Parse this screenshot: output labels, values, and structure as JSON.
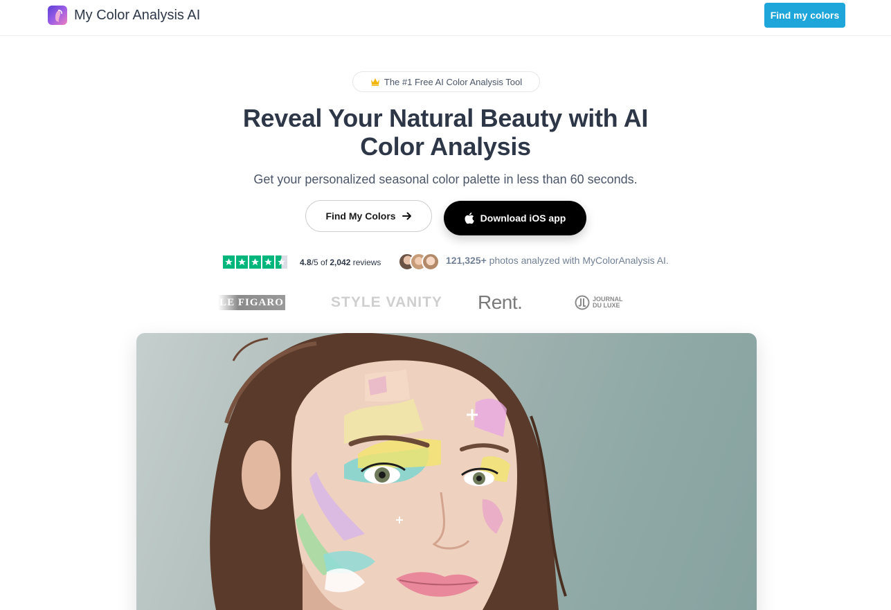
{
  "header": {
    "brand": "My Color Analysis AI",
    "cta_label": "Find my colors"
  },
  "hero": {
    "badge_icon": "crown-icon",
    "badge_text": "The #1 Free AI Color Analysis Tool",
    "headline_line1": "Reveal Your Natural Beauty with AI",
    "headline_line2": "Color Analysis",
    "subheadline": "Get your personalized seasonal color palette in less than 60 seconds.",
    "primary_button_label": "Find My Colors",
    "primary_button_icon": "arrow-right-icon",
    "secondary_button_label": "Download iOS app",
    "secondary_button_icon": "apple-icon"
  },
  "social_proof": {
    "rating_value": "4.8",
    "rating_scale": "/5 of ",
    "review_count": "2,042",
    "reviews_label": " reviews",
    "stars": 4.5,
    "photos_count": "121,325+",
    "photos_label": " photos analyzed with MyColorAnalysis AI."
  },
  "press": {
    "logo1": "LE FIGARO",
    "logo2": "STYLE VANITY",
    "logo3": "Rent.",
    "logo4_line1": "JOURNAL",
    "logo4_line2": "DU LUXE"
  },
  "colors": {
    "accent": "#1ea5d9",
    "trustpilot_green": "#00b67a",
    "heading": "#2d3748",
    "dark_button": "#000000"
  }
}
